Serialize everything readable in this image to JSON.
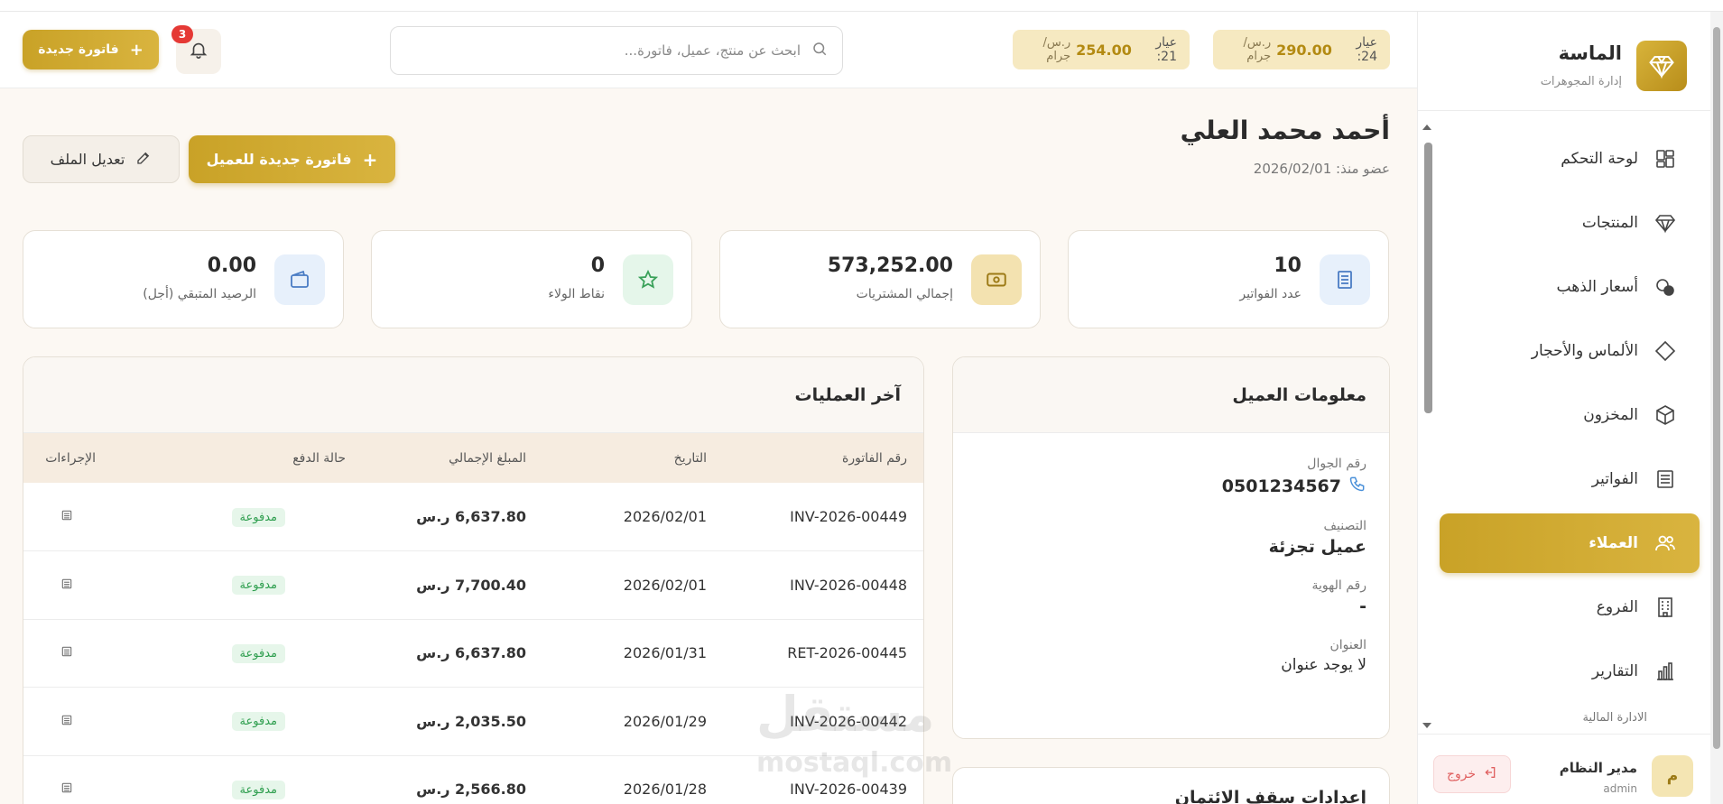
{
  "app": {
    "brand_name": "الماسة",
    "brand_sub": "إدارة المجوهرات"
  },
  "sidebar": {
    "items": [
      {
        "label": "لوحة التحكم",
        "icon": "dashboard-icon"
      },
      {
        "label": "المنتجات",
        "icon": "diamond-icon"
      },
      {
        "label": "أسعار الذهب",
        "icon": "gold-prices-icon"
      },
      {
        "label": "الألماس والأحجار",
        "icon": "gem-outline-icon"
      },
      {
        "label": "المخزون",
        "icon": "box-icon"
      },
      {
        "label": "الفواتير",
        "icon": "invoice-icon"
      },
      {
        "label": "العملاء",
        "icon": "users-icon",
        "active": true
      },
      {
        "label": "الفروع",
        "icon": "building-icon"
      },
      {
        "label": "التقارير",
        "icon": "chart-icon"
      }
    ],
    "section_label": "الادارة المالية",
    "user": {
      "initial": "م",
      "name": "مدير النظام",
      "role": "admin",
      "logout_label": "خروج"
    }
  },
  "header": {
    "price_24": {
      "karat": "عيار 24:",
      "price": "290.00",
      "unit": "ر.س/جرام"
    },
    "price_21": {
      "karat": "عيار 21:",
      "price": "254.00",
      "unit": "ر.س/جرام"
    },
    "search_placeholder": "ابحث عن منتج، عميل، فاتورة...",
    "notification_count": "3",
    "new_invoice_label": "فاتورة جديدة"
  },
  "customer": {
    "name": "أحمد محمد العلي",
    "member_since": "عضو منذ: 2026/02/01",
    "new_invoice_btn": "فاتورة جديدة للعميل",
    "edit_btn": "تعديل الملف"
  },
  "stats": [
    {
      "value": "10",
      "label": "عدد الفواتير",
      "icon": "receipt-icon"
    },
    {
      "value": "573,252.00",
      "label": "إجمالي المشتريات",
      "icon": "money-icon"
    },
    {
      "value": "0",
      "label": "نقاط الولاء",
      "icon": "star-icon"
    },
    {
      "value": "0.00",
      "label": "الرصيد المتبقي (أجل)",
      "icon": "wallet-icon"
    }
  ],
  "info_card": {
    "title": "معلومات العميل",
    "phone_label": "رقم الجوال",
    "phone": "0501234567",
    "category_label": "التصنيف",
    "category": "عميل تجزئة",
    "id_label": "رقم الهوية",
    "id_value": "-",
    "address_label": "العنوان",
    "address": "لا يوجد عنوان",
    "next_card_title": "إعدادات سقف الائتمان"
  },
  "transactions": {
    "title": "آخر العمليات",
    "columns": [
      "رقم الفاتورة",
      "التاريخ",
      "المبلغ الإجمالي",
      "حالة الدفع",
      "الإجراءات"
    ],
    "rows": [
      {
        "invoice": "INV-2026-00449",
        "date": "2026/02/01",
        "amount": "6,637.80 ر.س",
        "status": "مدفوعة"
      },
      {
        "invoice": "INV-2026-00448",
        "date": "2026/02/01",
        "amount": "7,700.40 ر.س",
        "status": "مدفوعة"
      },
      {
        "invoice": "RET-2026-00445",
        "date": "2026/01/31",
        "amount": "6,637.80 ر.س",
        "status": "مدفوعة"
      },
      {
        "invoice": "INV-2026-00442",
        "date": "2026/01/29",
        "amount": "2,035.50 ر.س",
        "status": "مدفوعة"
      },
      {
        "invoice": "INV-2026-00439",
        "date": "2026/01/28",
        "amount": "2,566.80 ر.س",
        "status": "مدفوعة"
      }
    ]
  },
  "watermark": {
    "arabic": "مستقل",
    "latin": "mostaql.com"
  }
}
